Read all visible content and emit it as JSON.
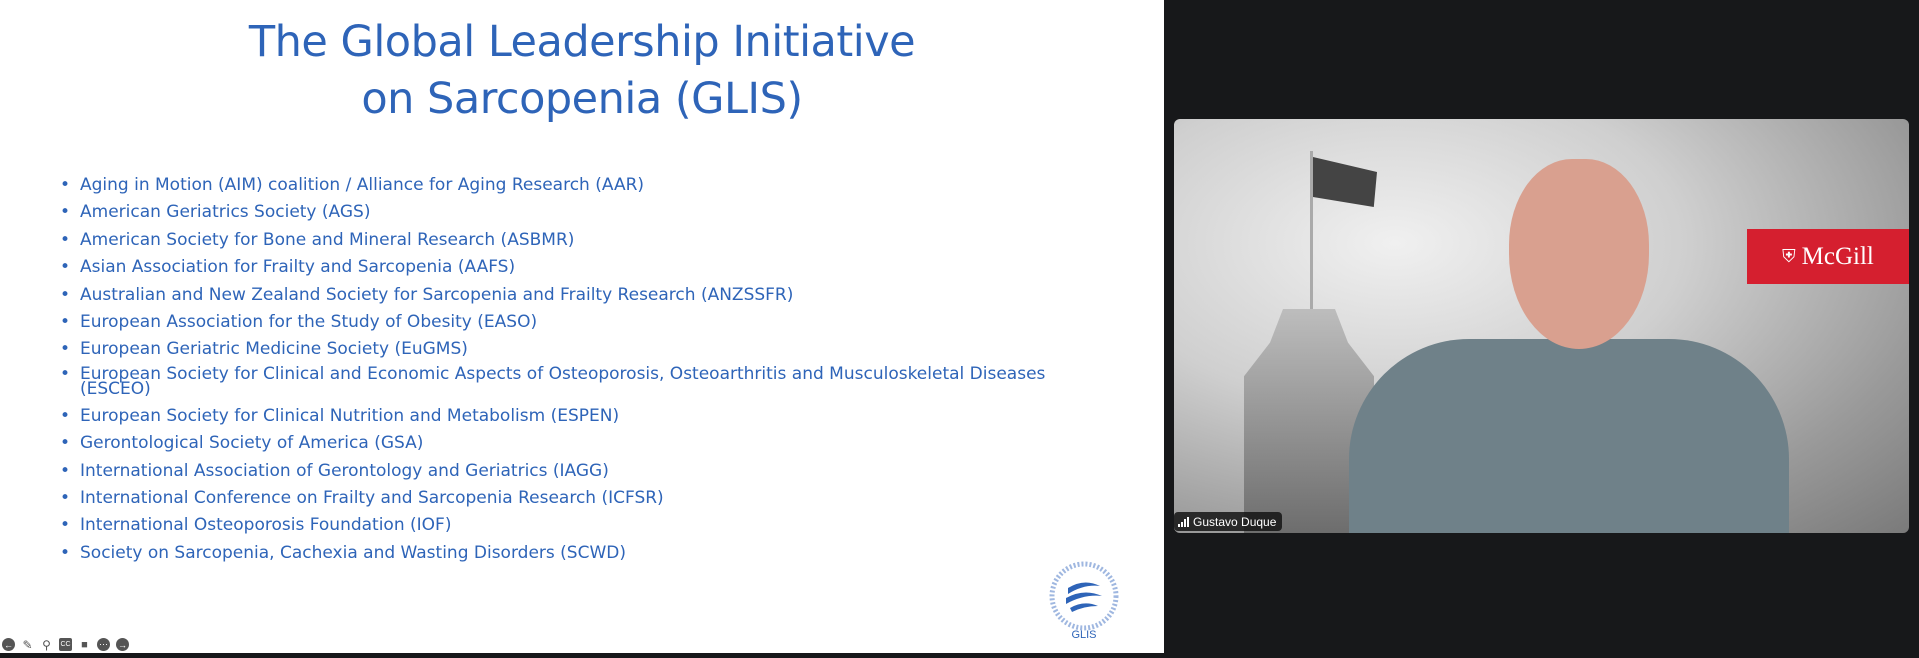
{
  "slide": {
    "title_line1": "The Global Leadership Initiative",
    "title_line2": "on Sarcopenia (GLIS)",
    "items": [
      "Aging in Motion (AIM) coalition / Alliance for Aging Research (AAR)",
      "American Geriatrics Society (AGS)",
      "American Society for Bone and Mineral Research (ASBMR)",
      "Asian Association for Frailty and Sarcopenia (AAFS)",
      "Australian and New Zealand Society for Sarcopenia and Frailty Research (ANZSSFR)",
      "European Association for the Study of Obesity (EASO)",
      "European Geriatric Medicine Society (EuGMS)",
      "European Society for Clinical and Economic Aspects of Osteoporosis, Osteoarthritis and Musculoskeletal Diseases (ESCEO)",
      "European Society for Clinical Nutrition and Metabolism (ESPEN)",
      "Gerontological Society of America (GSA)",
      "International Association of Gerontology and Geriatrics (IAGG)",
      "International Conference on Frailty and Sarcopenia Research (ICFSR)",
      "International Osteoporosis Foundation (IOF)",
      "Society on Sarcopenia, Cachexia and Wasting Disorders (SCWD)"
    ],
    "logo_text": "GLIS",
    "logo_ring_text": "GLOBAL LEADERSHIP INITIATIVE IN SARCOPENIA"
  },
  "toolbar": {
    "cc_label": "CC",
    "icons": [
      "arrow-left-icon",
      "pen-icon",
      "zoom-icon",
      "cc-icon",
      "video-icon",
      "more-icon",
      "arrow-right-icon"
    ]
  },
  "video": {
    "participant_name": "Gustavo Duque",
    "brand_label": "McGill",
    "brand_color": "#d51f2f"
  },
  "colors": {
    "accent": "#2e64b8",
    "background": "#17181a"
  }
}
